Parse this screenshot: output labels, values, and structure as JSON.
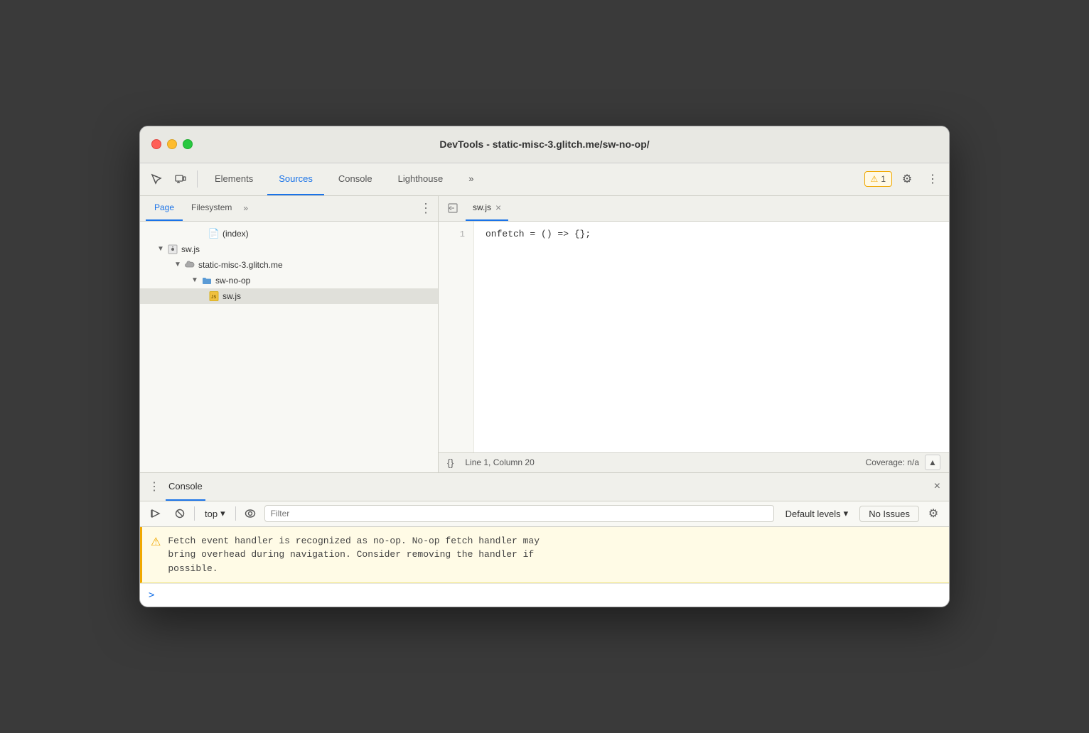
{
  "window": {
    "title": "DevTools - static-misc-3.glitch.me/sw-no-op/"
  },
  "titlebar": {
    "close_label": "",
    "minimize_label": "",
    "maximize_label": ""
  },
  "main_toolbar": {
    "inspect_icon": "⬚",
    "device_icon": "⧉",
    "tabs": [
      {
        "id": "elements",
        "label": "Elements",
        "active": false
      },
      {
        "id": "sources",
        "label": "Sources",
        "active": true
      },
      {
        "id": "console",
        "label": "Console",
        "active": false
      },
      {
        "id": "lighthouse",
        "label": "Lighthouse",
        "active": false
      }
    ],
    "more_tabs_label": "»",
    "warning_count": "1",
    "settings_icon": "⚙",
    "menu_icon": "⋮"
  },
  "left_panel": {
    "tabs": [
      {
        "id": "page",
        "label": "Page",
        "active": true
      },
      {
        "id": "filesystem",
        "label": "Filesystem",
        "active": false
      }
    ],
    "more_tabs": "»",
    "menu_icon": "⋮",
    "file_tree": [
      {
        "id": "index",
        "label": "(index)",
        "indent": 4,
        "type": "file",
        "icon": "📄"
      },
      {
        "id": "sw-js-root",
        "label": "sw.js",
        "indent": 1,
        "type": "gear-file",
        "arrow": "▼",
        "has_arrow": true
      },
      {
        "id": "domain",
        "label": "static-misc-3.glitch.me",
        "indent": 2,
        "type": "cloud",
        "arrow": "▼",
        "has_arrow": true
      },
      {
        "id": "sw-no-op",
        "label": "sw-no-op",
        "indent": 3,
        "type": "folder",
        "arrow": "▼",
        "has_arrow": true
      },
      {
        "id": "sw-js-file",
        "label": "sw.js",
        "indent": 4,
        "type": "js-file",
        "selected": true
      }
    ]
  },
  "editor": {
    "tab_label": "sw.js",
    "back_icon": "◀",
    "close_icon": "×",
    "code_lines": [
      {
        "number": "1",
        "content": "onfetch = () => {};"
      }
    ]
  },
  "status_bar": {
    "format_icon": "{}",
    "position": "Line 1, Column 20",
    "coverage": "Coverage: n/a",
    "up_icon": "▲"
  },
  "console_header": {
    "menu_icon": "⋮",
    "title": "Console",
    "close_icon": "×"
  },
  "console_toolbar": {
    "run_icon": "▶",
    "block_icon": "⊘",
    "context_label": "top",
    "context_arrow": "▾",
    "eye_icon": "👁",
    "filter_placeholder": "Filter",
    "levels_label": "Default levels",
    "levels_arrow": "▾",
    "issues_label": "No Issues",
    "settings_icon": "⚙"
  },
  "console_messages": [
    {
      "type": "warning",
      "text": "Fetch event handler is recognized as no-op. No-op fetch handler may\nbring overhead during navigation. Consider removing the handler if\npossible."
    }
  ],
  "console_input": {
    "prompt": ">"
  }
}
